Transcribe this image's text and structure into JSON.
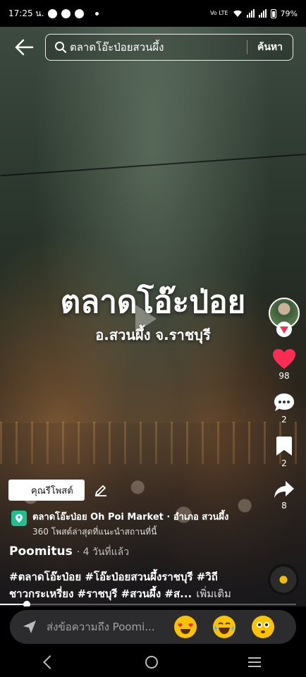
{
  "status_bar": {
    "time": "17:25 น.",
    "network": "Vo LTE",
    "battery": "79%"
  },
  "search": {
    "query": "ตลาดโอ๊ะป่อยสวนผึ้ง",
    "button_label": "ค้นหา"
  },
  "video": {
    "overlay_title": "ตลาดโอ๊ะป่อย",
    "overlay_subtitle": "อ.สวนผึ้ง จ.ราชบุรี",
    "progress_fraction": 0.09
  },
  "actions": {
    "likes": "98",
    "comments": "2",
    "bookmarks": "2",
    "shares": "8"
  },
  "poster": {
    "chip_label": "คุณรีโพสต์"
  },
  "place": {
    "name": "ตลาดโอ๊ะป่อย Oh Poi Market · อำเภอ สวนผึ้ง",
    "detail": "360 โพสต์ล่าสุดที่แนะนำสถานที่นี้"
  },
  "author": {
    "name": "Poomitus",
    "time": "· 4 วันที่แล้ว"
  },
  "caption": {
    "line1": "#ตลาดโอ๊ะป่อย #โอ๊ะป่อยสวนผึ้งราชบุรี #วิถี",
    "line2": "ชาวกระเหรี่ยง #ราชบุรี #สวนผึ้ง #ส...",
    "more": "เพิ่มเติม"
  },
  "comment": {
    "placeholder": "ส่งข้อความถึง Poomi..."
  },
  "colors": {
    "like": "#fe2c55",
    "place_badge": "#1fbf8f",
    "comment_box": "#2c2c2e"
  }
}
